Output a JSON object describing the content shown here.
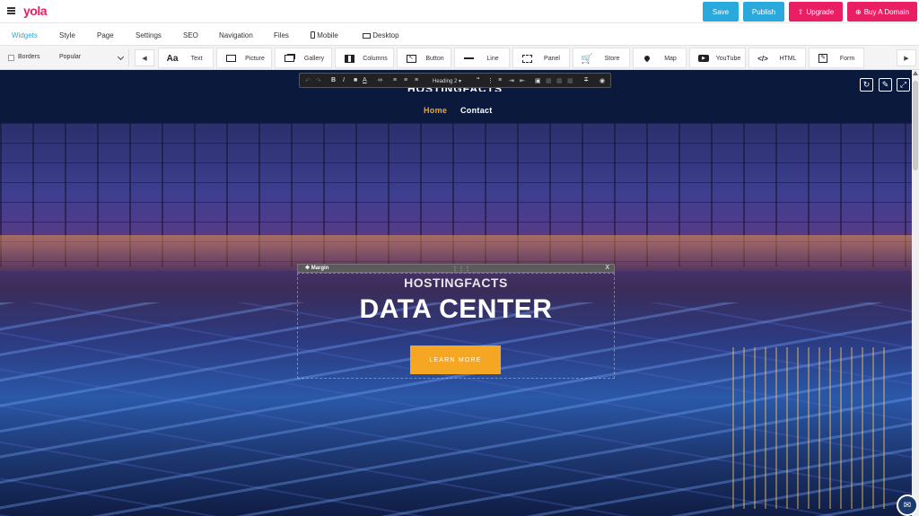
{
  "topbar": {
    "logo": "yola",
    "save": "Save",
    "publish": "Publish",
    "upgrade": "Upgrade",
    "buy_domain": "Buy A Domain",
    "colors": {
      "save": "#29a9dc",
      "publish": "#29a9dc",
      "upgrade": "#e91e63",
      "buy_domain": "#e91e63"
    }
  },
  "menu": {
    "items": [
      "Widgets",
      "Style",
      "Page",
      "Settings",
      "SEO",
      "Navigation",
      "Files",
      "Mobile",
      "Desktop"
    ],
    "active": "Widgets"
  },
  "widgets": {
    "borders_label": "Borders",
    "category": "Popular",
    "items": [
      {
        "label": "Text",
        "icon": "text-icon"
      },
      {
        "label": "Picture",
        "icon": "picture-icon"
      },
      {
        "label": "Gallery",
        "icon": "gallery-icon"
      },
      {
        "label": "Columns",
        "icon": "columns-icon"
      },
      {
        "label": "Button",
        "icon": "button-icon"
      },
      {
        "label": "Line",
        "icon": "line-icon"
      },
      {
        "label": "Panel",
        "icon": "panel-icon"
      },
      {
        "label": "Store",
        "icon": "cart-icon"
      },
      {
        "label": "Map",
        "icon": "map-pin-icon"
      },
      {
        "label": "YouTube",
        "icon": "youtube-icon"
      },
      {
        "label": "HTML",
        "icon": "code-icon"
      },
      {
        "label": "Form",
        "icon": "form-icon"
      }
    ]
  },
  "editor": {
    "heading_select": "Heading 2",
    "margin_label": "Margin",
    "margin_close": "X"
  },
  "site": {
    "title": "HOSTINGFACTS",
    "nav": [
      {
        "label": "Home",
        "active": true
      },
      {
        "label": "Contact",
        "active": false
      }
    ],
    "hero": {
      "subtitle": "HOSTINGFACTS",
      "title": "DATA CENTER",
      "button": "LEARN MORE"
    },
    "colors": {
      "nav_active": "#f5a623",
      "button": "#f5a623",
      "header_bg": "#0b1a3c"
    }
  }
}
